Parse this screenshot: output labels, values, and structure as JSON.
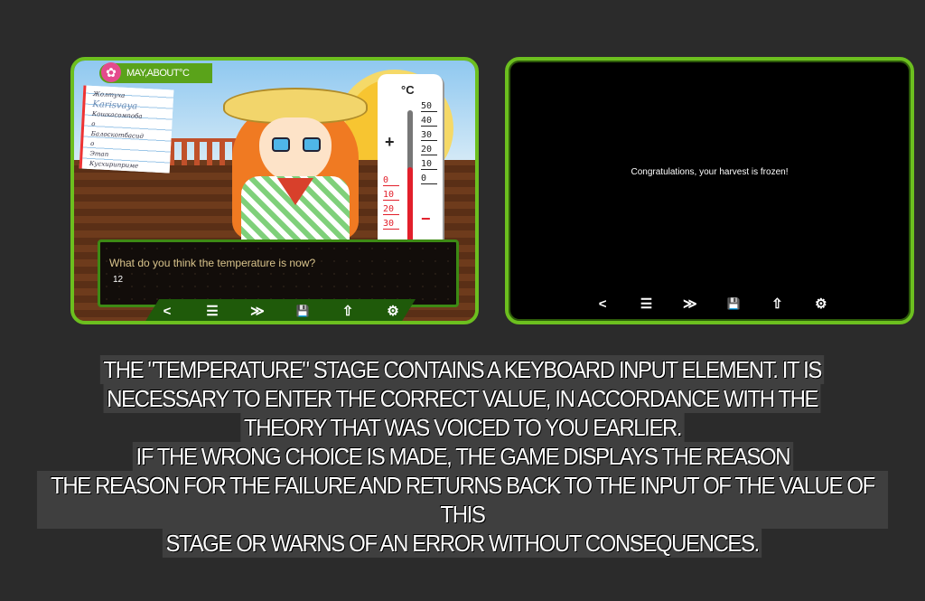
{
  "left_panel": {
    "name_tag": "MAY,ABOUT°C",
    "notepad_lines": [
      "Жолтуха",
      "Karisvaya",
      "Кошкасомпоба",
      "о",
      "Балоскотбасид",
      "о",
      "Этап",
      "Кусхириприме"
    ],
    "thermometer": {
      "unit": "°C",
      "plus": "+",
      "minus": "−",
      "positive_ticks": [
        "50",
        "40",
        "30",
        "20",
        "10",
        "0"
      ],
      "negative_ticks": [
        "0",
        "10",
        "20",
        "30"
      ]
    },
    "dialog": {
      "prompt": "What do you think the temperature is now?",
      "answer": "12"
    }
  },
  "right_panel": {
    "message": "Congratulations, your harvest is frozen!"
  },
  "toolbar": {
    "back": "<",
    "menu": "☰",
    "skip": "≫",
    "save": "💾",
    "share": "⇧",
    "settings": "⚙"
  },
  "caption": [
    "THE \"TEMPERATURE\" STAGE CONTAINS A KEYBOARD INPUT ELEMENT. IT IS",
    "NECESSARY TO ENTER THE CORRECT VALUE, IN ACCORDANCE WITH THE",
    "THEORY THAT WAS VOICED TO YOU EARLIER.",
    "IF THE WRONG CHOICE IS MADE, THE GAME DISPLAYS THE REASON",
    "THE REASON FOR THE FAILURE AND RETURNS BACK TO THE INPUT OF THE VALUE OF THIS",
    "STAGE OR WARNS OF AN ERROR WITHOUT CONSEQUENCES."
  ],
  "colors": {
    "frame": "#6cbf1f",
    "toolbar_bg": "#1f5a0a",
    "thermo_red": "#e21f2b"
  }
}
